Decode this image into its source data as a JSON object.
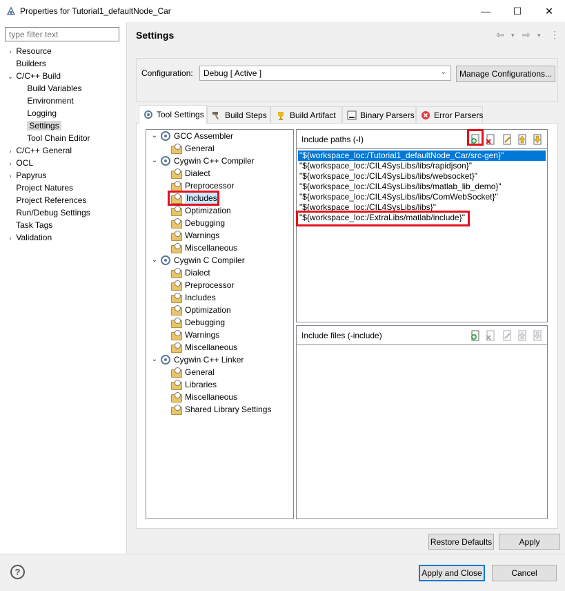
{
  "window": {
    "title": "Properties for Tutorial1_defaultNode_Car",
    "minimize": "—",
    "maximize": "☐",
    "close": "✕"
  },
  "sidebar": {
    "filter_placeholder": "type filter text",
    "items": [
      {
        "label": "Resource",
        "expander": "›"
      },
      {
        "label": "Builders",
        "expander": ""
      },
      {
        "label": "C/C++ Build",
        "expander": "⌄"
      },
      {
        "label": "Build Variables",
        "expander": ""
      },
      {
        "label": "Environment",
        "expander": ""
      },
      {
        "label": "Logging",
        "expander": ""
      },
      {
        "label": "Settings",
        "expander": ""
      },
      {
        "label": "Tool Chain Editor",
        "expander": ""
      },
      {
        "label": "C/C++ General",
        "expander": "›"
      },
      {
        "label": "OCL",
        "expander": "›"
      },
      {
        "label": "Papyrus",
        "expander": "›"
      },
      {
        "label": "Project Natures",
        "expander": ""
      },
      {
        "label": "Project References",
        "expander": ""
      },
      {
        "label": "Run/Debug Settings",
        "expander": ""
      },
      {
        "label": "Task Tags",
        "expander": ""
      },
      {
        "label": "Validation",
        "expander": "›"
      }
    ]
  },
  "header": {
    "title": "Settings",
    "back": "⇦",
    "forward": "⇨",
    "menu_caret": "▾",
    "more": "⋮"
  },
  "configuration": {
    "label": "Configuration:",
    "value": "Debug  [ Active ]",
    "caret": "⌄",
    "manage_label": "Manage Configurations..."
  },
  "tabs": [
    {
      "label": "Tool Settings",
      "icon": "gear-icon"
    },
    {
      "label": "Build Steps",
      "icon": "hammer-icon"
    },
    {
      "label": "Build Artifact",
      "icon": "trophy-icon"
    },
    {
      "label": "Binary Parsers",
      "icon": "binary-icon"
    },
    {
      "label": "Error Parsers",
      "icon": "error-icon"
    }
  ],
  "tree": {
    "collapse": "⌄",
    "nodes": [
      {
        "label": "GCC Assembler"
      },
      {
        "label": "General"
      },
      {
        "label": "Cygwin C++ Compiler"
      },
      {
        "label": "Dialect"
      },
      {
        "label": "Preprocessor"
      },
      {
        "label": "Includes"
      },
      {
        "label": "Optimization"
      },
      {
        "label": "Debugging"
      },
      {
        "label": "Warnings"
      },
      {
        "label": "Miscellaneous"
      },
      {
        "label": "Cygwin C Compiler"
      },
      {
        "label": "Dialect"
      },
      {
        "label": "Preprocessor"
      },
      {
        "label": "Includes"
      },
      {
        "label": "Optimization"
      },
      {
        "label": "Debugging"
      },
      {
        "label": "Warnings"
      },
      {
        "label": "Miscellaneous"
      },
      {
        "label": "Cygwin C++ Linker"
      },
      {
        "label": "General"
      },
      {
        "label": "Libraries"
      },
      {
        "label": "Miscellaneous"
      },
      {
        "label": "Shared Library Settings"
      }
    ]
  },
  "include_paths": {
    "title": "Include paths (-I)",
    "items": [
      "\"${workspace_loc:/Tutorial1_defaultNode_Car/src-gen}\"",
      "\"${workspace_loc:/CIL4SysLibs/libs/rapidjson}\"",
      "\"${workspace_loc:/CIL4SysLibs/libs/websocket}\"",
      "\"${workspace_loc:/CIL4SysLibs/libs/matlab_lib_demo}\"",
      "\"${workspace_loc:/CIL4SysLibs/libs/ComWebSocket}\"",
      "\"${workspace_loc:/CIL4SysLibs/libs}\"",
      "\"${workspace_loc:/ExtraLibs/matlab/include}\""
    ]
  },
  "include_files": {
    "title": "Include files (-include)"
  },
  "toolbar_icons": {
    "add": "+",
    "delete": "✕",
    "edit": "✎",
    "move_up": "⇧",
    "move_down": "⇩"
  },
  "buttons": {
    "restore_defaults": "Restore Defaults",
    "apply": "Apply",
    "apply_and_close": "Apply and Close",
    "cancel": "Cancel",
    "help": "?"
  },
  "colors": {
    "highlight_red": "#e0121e",
    "selection_blue": "#0078d7"
  }
}
